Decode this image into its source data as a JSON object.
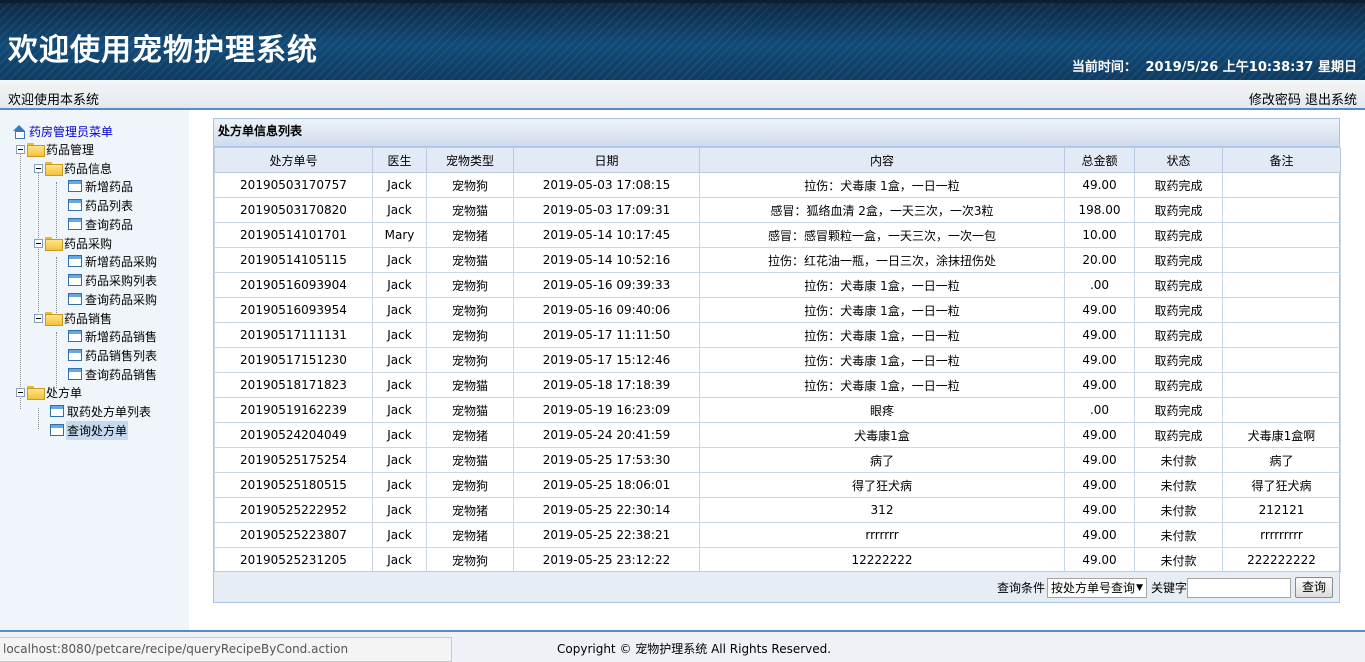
{
  "header": {
    "title": "欢迎使用宠物护理系统",
    "time_label": "当前时间：",
    "time_value": "2019/5/26 上午10:38:37 星期日"
  },
  "subbar": {
    "welcome": "欢迎使用本系统",
    "change_password": "修改密码",
    "logout": "退出系统"
  },
  "sidebar": {
    "root": "药房管理员菜单",
    "drug_mgmt": "药品管理",
    "drug_info": "药品信息",
    "add_drug": "新增药品",
    "drug_list": "药品列表",
    "query_drug": "查询药品",
    "drug_purchase": "药品采购",
    "add_purchase": "新增药品采购",
    "purchase_list": "药品采购列表",
    "query_purchase": "查询药品采购",
    "drug_sales": "药品销售",
    "add_sale": "新增药品销售",
    "sale_list": "药品销售列表",
    "query_sale": "查询药品销售",
    "prescription": "处方单",
    "pickup_list": "取药处方单列表",
    "query_prescription": "查询处方单"
  },
  "panel": {
    "title": "处方单信息列表",
    "columns": [
      "处方单号",
      "医生",
      "宠物类型",
      "日期",
      "内容",
      "总金额",
      "状态",
      "备注"
    ],
    "rows": [
      [
        "20190503170757",
        "Jack",
        "宠物狗",
        "2019-05-03 17:08:15",
        "拉伤：犬毒康 1盒，一日一粒",
        "49.00",
        "取药完成",
        ""
      ],
      [
        "20190503170820",
        "Jack",
        "宠物猫",
        "2019-05-03 17:09:31",
        "感冒：狐络血清 2盒，一天三次，一次3粒",
        "198.00",
        "取药完成",
        ""
      ],
      [
        "20190514101701",
        "Mary",
        "宠物猪",
        "2019-05-14 10:17:45",
        "感冒：感冒颗粒一盒，一天三次，一次一包",
        "10.00",
        "取药完成",
        ""
      ],
      [
        "20190514105115",
        "Jack",
        "宠物猫",
        "2019-05-14 10:52:16",
        "拉伤：红花油一瓶，一日三次，涂抹扭伤处",
        "20.00",
        "取药完成",
        ""
      ],
      [
        "20190516093904",
        "Jack",
        "宠物狗",
        "2019-05-16 09:39:33",
        "拉伤：犬毒康 1盒，一日一粒",
        ".00",
        "取药完成",
        ""
      ],
      [
        "20190516093954",
        "Jack",
        "宠物狗",
        "2019-05-16 09:40:06",
        "拉伤：犬毒康 1盒，一日一粒",
        "49.00",
        "取药完成",
        ""
      ],
      [
        "20190517111131",
        "Jack",
        "宠物狗",
        "2019-05-17 11:11:50",
        "拉伤：犬毒康 1盒，一日一粒",
        "49.00",
        "取药完成",
        ""
      ],
      [
        "20190517151230",
        "Jack",
        "宠物狗",
        "2019-05-17 15:12:46",
        "拉伤：犬毒康 1盒，一日一粒",
        "49.00",
        "取药完成",
        ""
      ],
      [
        "20190518171823",
        "Jack",
        "宠物猫",
        "2019-05-18 17:18:39",
        "拉伤：犬毒康 1盒，一日一粒",
        "49.00",
        "取药完成",
        ""
      ],
      [
        "20190519162239",
        "Jack",
        "宠物猫",
        "2019-05-19 16:23:09",
        "眼疼",
        ".00",
        "取药完成",
        ""
      ],
      [
        "20190524204049",
        "Jack",
        "宠物猪",
        "2019-05-24 20:41:59",
        "犬毒康1盒",
        "49.00",
        "取药完成",
        "犬毒康1盒啊"
      ],
      [
        "20190525175254",
        "Jack",
        "宠物猫",
        "2019-05-25 17:53:30",
        "病了",
        "49.00",
        "未付款",
        "病了"
      ],
      [
        "20190525180515",
        "Jack",
        "宠物狗",
        "2019-05-25 18:06:01",
        "得了狂犬病",
        "49.00",
        "未付款",
        "得了狂犬病"
      ],
      [
        "20190525222952",
        "Jack",
        "宠物猪",
        "2019-05-25 22:30:14",
        "312",
        "49.00",
        "未付款",
        "212121"
      ],
      [
        "20190525223807",
        "Jack",
        "宠物猪",
        "2019-05-25 22:38:21",
        "rrrrrrr",
        "49.00",
        "未付款",
        "rrrrrrrrr"
      ],
      [
        "20190525231205",
        "Jack",
        "宠物狗",
        "2019-05-25 23:12:22",
        "12222222",
        "49.00",
        "未付款",
        "222222222"
      ]
    ],
    "search": {
      "cond_label": "查询条件",
      "cond_value": "按处方单号查询",
      "keyword_label": "关键字",
      "keyword_value": "",
      "button": "查询"
    }
  },
  "footer": {
    "copyright": "Copyright © 宠物护理系统 All Rights Reserved.",
    "status_url": "localhost:8080/petcare/recipe/queryRecipeByCond.action"
  }
}
